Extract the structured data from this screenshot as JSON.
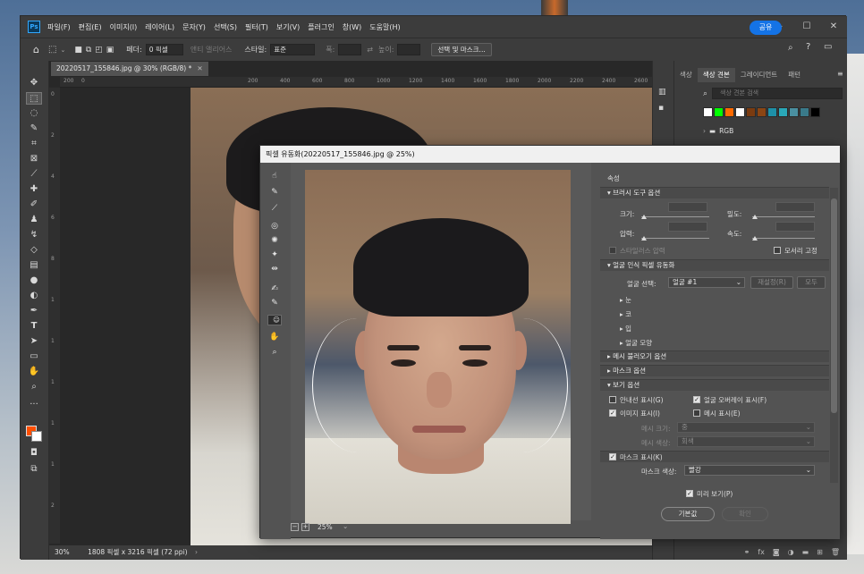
{
  "menu": {
    "logo": "Ps",
    "items": [
      "파일(F)",
      "편집(E)",
      "이미지(I)",
      "레이어(L)",
      "문자(Y)",
      "선택(S)",
      "필터(T)",
      "보기(V)",
      "플러그인",
      "창(W)",
      "도움말(H)"
    ]
  },
  "options": {
    "feather_label": "페더:",
    "feather_value": "0 픽셀",
    "antialias": "앤티 앨리어스",
    "style_label": "스타일:",
    "style_value": "표준",
    "width_label": "폭:",
    "height_label": "높이:",
    "select_mask": "선택 및 마스크...",
    "share": "공유"
  },
  "document": {
    "tab": "20220517_155846.jpg @ 30% (RGB/8) *",
    "ruler_top": [
      "200",
      "0",
      "200",
      "400",
      "600",
      "800",
      "1000",
      "1200",
      "1400",
      "1600",
      "1800",
      "2000",
      "2200",
      "2400",
      "2600"
    ],
    "ruler_left": [
      "0",
      "2",
      "4",
      "6",
      "8",
      "1",
      "1",
      "1",
      "1",
      "1",
      "2"
    ],
    "zoom": "30%",
    "size": "1808 픽셀 x 3216 픽셀 (72 ppi)"
  },
  "right_panel": {
    "tabs": [
      "색상",
      "색상 견본",
      "그레이디언트",
      "패턴"
    ],
    "active_tab": 1,
    "search_placeholder": "색상 견본 검색",
    "swatch_colors": [
      "#ffffff",
      "#00ff00",
      "#ff6a00",
      "#ffffff",
      "#7a3b10",
      "#8b4513",
      "#1e90a8",
      "#2aa8b8",
      "#4a8fa0",
      "#3a7a8a",
      "#000000"
    ],
    "folder": "RGB"
  },
  "dialog": {
    "title": "픽셀 유동화(20220517_155846.jpg @ 25%)",
    "zoom": "25%",
    "props_title": "속성",
    "brush_section": "브러시 도구 옵션",
    "size_label": "크기:",
    "density_label": "밀도:",
    "pressure_label": "압력:",
    "rate_label": "속도:",
    "stylus": "스타일러스 압력",
    "pin_edges": "모서리 고정",
    "face_section": "얼굴 인식 픽셀 유동화",
    "face_select_label": "얼굴 선택:",
    "face_select_value": "얼굴 #1",
    "reset": "재설정(R)",
    "all": "모두",
    "face_items": [
      "눈",
      "코",
      "입",
      "얼굴 모양"
    ],
    "mesh_load": "메시 불러오기 옵션",
    "mask_options": "마스크 옵션",
    "view_section": "보기 옵션",
    "show_guides": "안내선 표시(G)",
    "show_face_overlay": "얼굴 오버레이 표시(F)",
    "show_image": "이미지 표시(I)",
    "show_mesh": "메시 표시(E)",
    "mesh_size_label": "메시 크기:",
    "mesh_size_value": "중",
    "mesh_color_label": "메시 색상:",
    "mesh_color_value": "회색",
    "show_mask": "마스크 표시(K)",
    "mask_color_label": "마스크 색상:",
    "mask_color_value": "빨강",
    "preview": "미리 보기(P)",
    "default_btn": "기본값",
    "ok_btn": "확인"
  }
}
